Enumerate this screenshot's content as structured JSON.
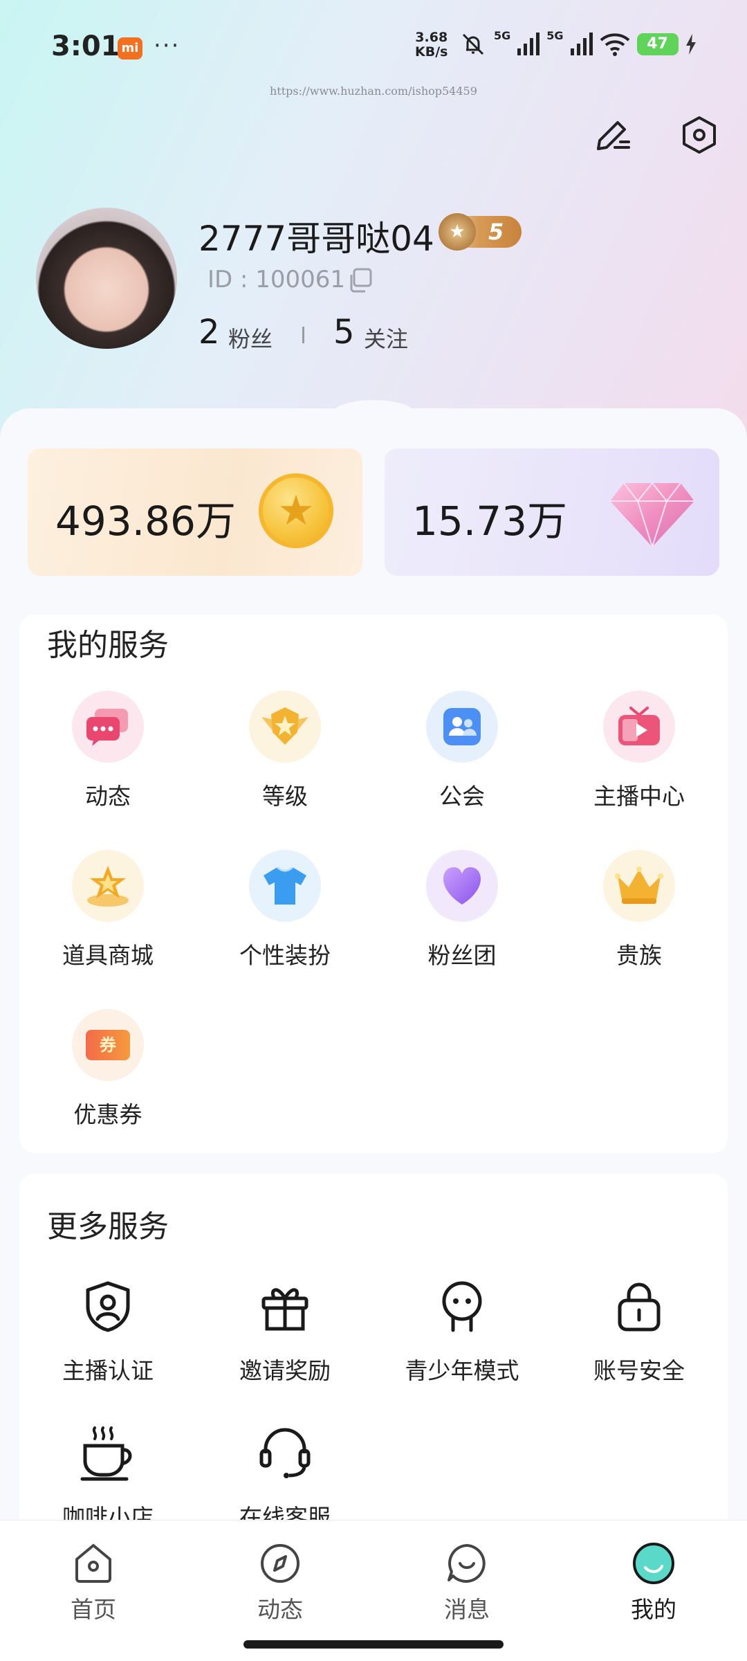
{
  "status_bar": {
    "time": "3:01",
    "notification": "mi",
    "more": "···",
    "net_speed_value": "3.68",
    "net_speed_unit": "KB/s",
    "signal_1_label": "5G",
    "signal_2_label": "5G",
    "battery": "47"
  },
  "watermark": "https://www.huzhan.com/ishop54459",
  "header": {
    "edit_icon": "edit-icon",
    "settings_icon": "settings-icon"
  },
  "profile": {
    "username": "2777哥哥哒04",
    "level": "5",
    "id_text": "ID : 100061",
    "fans_count": "2",
    "fans_label": "粉丝",
    "follow_count": "5",
    "follow_label": "关注"
  },
  "wallet": {
    "coins": "493.86万",
    "diamonds": "15.73万"
  },
  "my_services": {
    "title": "我的服务",
    "items": [
      {
        "label": "动态",
        "icon": "chat-bubble-icon"
      },
      {
        "label": "等级",
        "icon": "badge-icon"
      },
      {
        "label": "公会",
        "icon": "guild-icon"
      },
      {
        "label": "主播中心",
        "icon": "tv-icon"
      },
      {
        "label": "道具商城",
        "icon": "star-shop-icon"
      },
      {
        "label": "个性装扮",
        "icon": "tshirt-icon"
      },
      {
        "label": "粉丝团",
        "icon": "heart-icon"
      },
      {
        "label": "贵族",
        "icon": "crown-icon"
      },
      {
        "label": "优惠券",
        "icon": "coupon-icon"
      }
    ],
    "coupon_glyph": "券"
  },
  "more_services": {
    "title": "更多服务",
    "items": [
      {
        "label": "主播认证",
        "icon": "shield-user-icon"
      },
      {
        "label": "邀请奖励",
        "icon": "gift-icon"
      },
      {
        "label": "青少年模式",
        "icon": "teen-icon"
      },
      {
        "label": "账号安全",
        "icon": "lock-icon"
      },
      {
        "label": "咖啡小店",
        "icon": "coffee-icon"
      },
      {
        "label": "在线客服",
        "icon": "headset-icon"
      }
    ]
  },
  "bottom_nav": {
    "items": [
      {
        "label": "首页",
        "icon": "home-icon"
      },
      {
        "label": "动态",
        "icon": "compass-icon"
      },
      {
        "label": "消息",
        "icon": "message-icon"
      },
      {
        "label": "我的",
        "icon": "profile-icon",
        "active": true
      }
    ]
  },
  "colors": {
    "accent_teal": "#5ad8c8",
    "coin_gold": "#f7c33b",
    "diamond_pink": "#f08fc0"
  }
}
